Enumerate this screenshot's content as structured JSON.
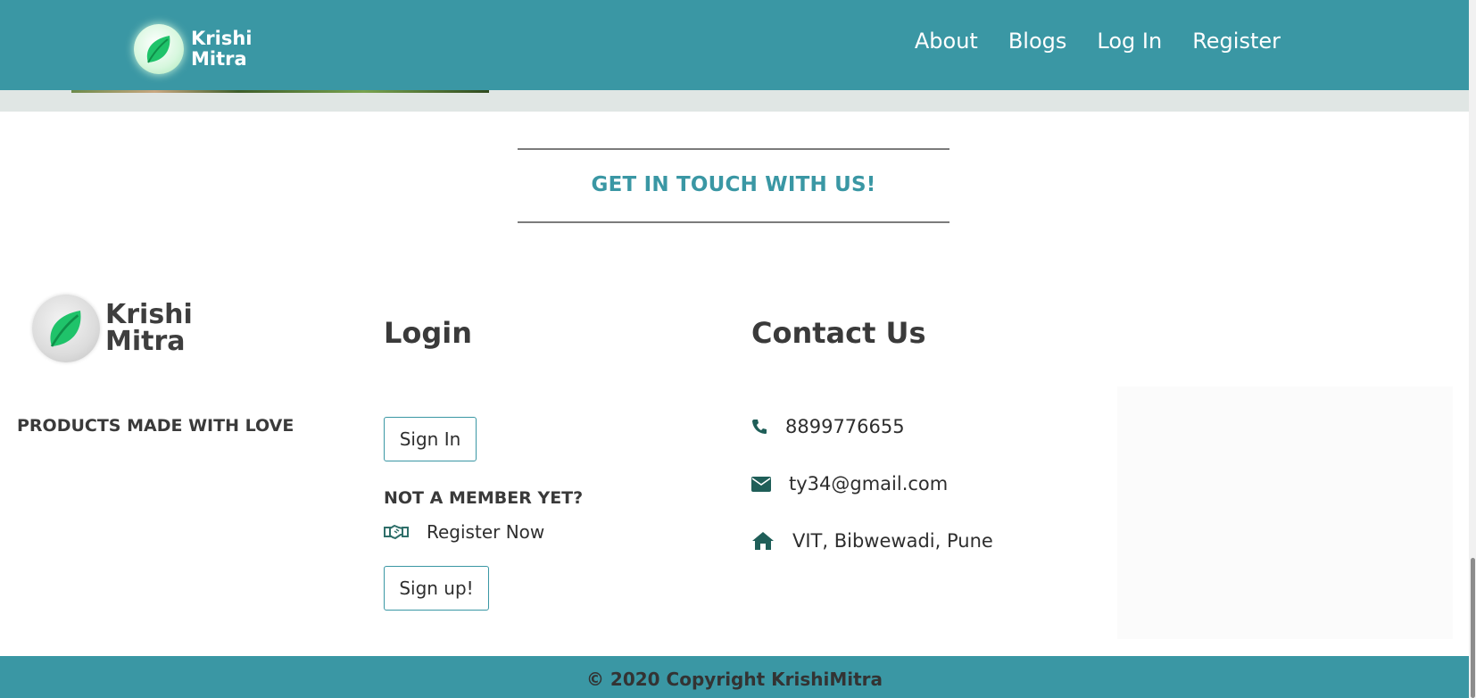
{
  "brand": {
    "line1": "Krishi",
    "line2": "Mitra",
    "logo_icon": "leaf-icon",
    "accent_color": "#3a97a4",
    "leaf_color": "#1fc36a"
  },
  "nav": {
    "items": [
      {
        "label": "About"
      },
      {
        "label": "Blogs"
      },
      {
        "label": "Log In"
      },
      {
        "label": "Register"
      }
    ]
  },
  "touch": {
    "title": "GET IN TOUCH WITH US!"
  },
  "footer": {
    "tagline": "PRODUCTS MADE WITH LOVE",
    "login": {
      "heading": "Login",
      "signin_label": "Sign In",
      "not_member": "NOT A MEMBER YET?",
      "register_icon": "handshake-icon",
      "register_label": "Register Now",
      "signup_label": "Sign up!"
    },
    "contact": {
      "heading": "Contact Us",
      "phone_icon": "phone-icon",
      "phone": "8899776655",
      "email_icon": "envelope-icon",
      "email": "ty34@gmail.com",
      "address_icon": "home-icon",
      "address": "VIT, Bibwewadi, Pune"
    }
  },
  "bottom": {
    "copyright": "© 2020 Copyright KrishiMitra"
  }
}
